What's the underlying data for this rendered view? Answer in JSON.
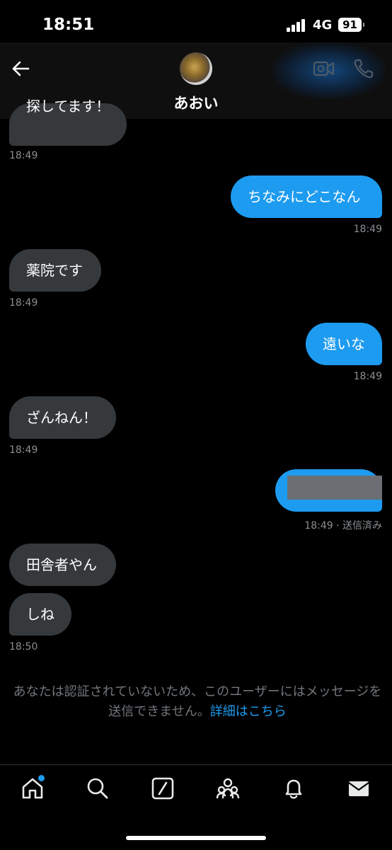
{
  "status_bar": {
    "time": "18:51",
    "network": "4G",
    "battery": "91"
  },
  "header": {
    "name": "あおい"
  },
  "messages": [
    {
      "text": "探してます！",
      "time": "18:49"
    },
    {
      "text": "ちなみにどこなん",
      "time": "18:49"
    },
    {
      "text": "薬院です",
      "time": "18:49"
    },
    {
      "text": "遠いな",
      "time": "18:49"
    },
    {
      "text": "ざんねん！",
      "time": "18:49"
    },
    {
      "text": "",
      "time": "18:49 · 送信済み"
    },
    {
      "text": "田舎者やん"
    },
    {
      "text": "しね",
      "time": "18:50"
    }
  ],
  "notice": {
    "text": "あなたは認証されていないため、このユーザーにはメッセージを送信できません。",
    "link": "詳細はこちら"
  },
  "colors": {
    "accent": "#1d9bf0",
    "received_bubble": "#36393c",
    "background": "#000000"
  },
  "icons": [
    "back-arrow-icon",
    "video-call-icon",
    "phone-icon",
    "home-icon",
    "search-icon",
    "grok-icon",
    "communities-icon",
    "bell-icon",
    "mail-icon"
  ]
}
